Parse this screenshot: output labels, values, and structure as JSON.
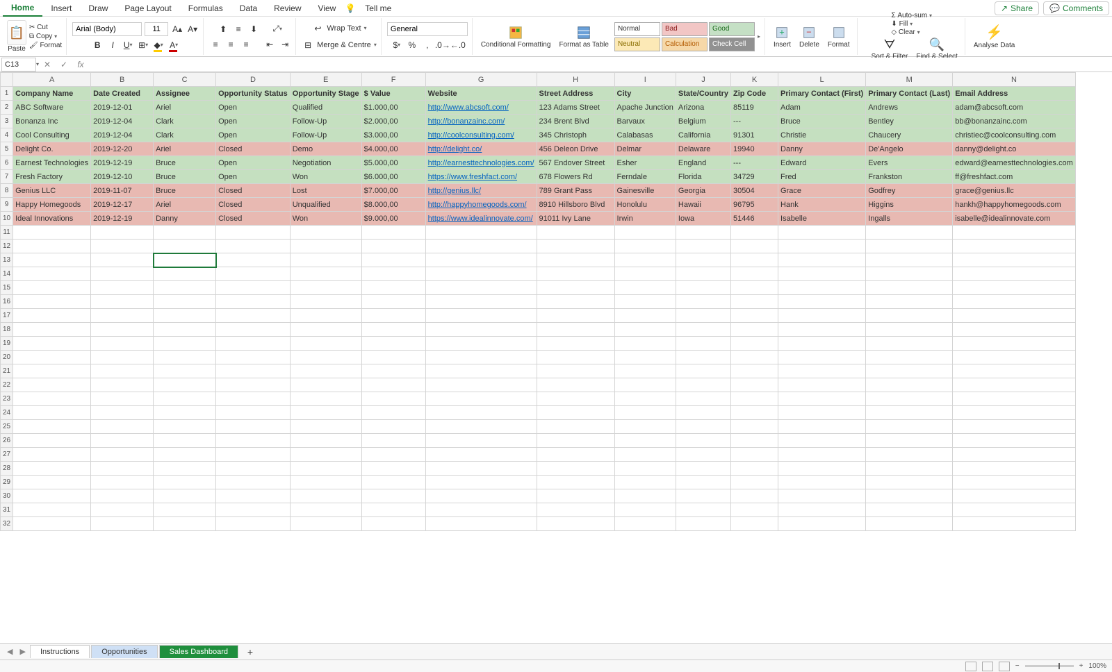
{
  "menu": {
    "tabs": [
      "Home",
      "Insert",
      "Draw",
      "Page Layout",
      "Formulas",
      "Data",
      "Review",
      "View"
    ],
    "tellme": "Tell me",
    "share": "Share",
    "comments": "Comments"
  },
  "ribbon": {
    "paste_lbl": "Paste",
    "cut": "Cut",
    "copy": "Copy",
    "format_p": "Format",
    "font_name": "Arial (Body)",
    "font_size": "11",
    "wrap": "Wrap Text",
    "merge": "Merge & Centre",
    "num_format": "General",
    "cf": "Conditional\nFormatting",
    "fat": "Format\nas Table",
    "styles": {
      "normal": "Normal",
      "bad": "Bad",
      "good": "Good",
      "neutral": "Neutral",
      "calc": "Calculation",
      "check": "Check Cell"
    },
    "insert": "Insert",
    "delete": "Delete",
    "format": "Format",
    "autosum": "Auto-sum",
    "fill": "Fill",
    "clear": "Clear",
    "sortfilter": "Sort &\nFilter",
    "findselect": "Find &\nSelect",
    "analyse": "Analyse\nData"
  },
  "fbar": {
    "cell": "C13"
  },
  "columns": [
    "A",
    "B",
    "C",
    "D",
    "E",
    "F",
    "G",
    "H",
    "I",
    "J",
    "K",
    "L",
    "M",
    "N"
  ],
  "headers": [
    "Company Name",
    "Date Created",
    "Assignee",
    "Opportunity Status",
    "Opportunity Stage",
    "$ Value",
    "Website",
    "Street Address",
    "City",
    "State/Country",
    "Zip Code",
    "Primary Contact (First)",
    "Primary Contact (Last)",
    "Email Address"
  ],
  "rows": [
    {
      "status": "open",
      "c": [
        "ABC Software",
        "2019-12-01",
        "Ariel",
        "Open",
        "Qualified",
        "$1.000,00",
        "http://www.abcsoft.com/",
        "123 Adams Street",
        "Apache Junction",
        "Arizona",
        "85119",
        "Adam",
        "Andrews",
        "adam@abcsoft.com"
      ]
    },
    {
      "status": "open",
      "c": [
        "Bonanza Inc",
        "2019-12-04",
        "Clark",
        "Open",
        "Follow-Up",
        "$2.000,00",
        "http://bonanzainc.com/",
        "234 Brent Blvd",
        "Barvaux",
        "Belgium",
        "---",
        "Bruce",
        "Bentley",
        "bb@bonanzainc.com"
      ]
    },
    {
      "status": "open",
      "c": [
        "Cool Consulting",
        "2019-12-04",
        "Clark",
        "Open",
        "Follow-Up",
        "$3.000,00",
        "http://coolconsulting.com/",
        "345 Christoph",
        "Calabasas",
        "California",
        "91301",
        "Christie",
        "Chaucery",
        "christiec@coolconsulting.com"
      ]
    },
    {
      "status": "closed",
      "c": [
        "Delight Co.",
        "2019-12-20",
        "Ariel",
        "Closed",
        "Demo",
        "$4.000,00",
        "http://delight.co/",
        "456 Deleon Drive",
        "Delmar",
        "Delaware",
        "19940",
        "Danny",
        "De'Angelo",
        "danny@delight.co"
      ]
    },
    {
      "status": "open",
      "c": [
        "Earnest Technologies",
        "2019-12-19",
        "Bruce",
        "Open",
        "Negotiation",
        "$5.000,00",
        "http://earnesttechnologies.com/",
        "567 Endover Street",
        "Esher",
        "England",
        "---",
        "Edward",
        "Evers",
        "edward@earnesttechnologies.com"
      ]
    },
    {
      "status": "open",
      "c": [
        "Fresh Factory",
        "2019-12-10",
        "Bruce",
        "Open",
        "Won",
        "$6.000,00",
        "https://www.freshfact.com/",
        "678 Flowers Rd",
        "Ferndale",
        "Florida",
        "34729",
        "Fred",
        "Frankston",
        "ff@freshfact.com"
      ]
    },
    {
      "status": "closed",
      "c": [
        "Genius LLC",
        "2019-11-07",
        "Bruce",
        "Closed",
        "Lost",
        "$7.000,00",
        "http://genius.llc/",
        "789 Grant Pass",
        "Gainesville",
        "Georgia",
        "30504",
        "Grace",
        "Godfrey",
        "grace@genius.llc"
      ]
    },
    {
      "status": "closed",
      "c": [
        "Happy Homegoods",
        "2019-12-17",
        "Ariel",
        "Closed",
        "Unqualified",
        "$8.000,00",
        "http://happyhomegoods.com/",
        "8910 Hillsboro Blvd",
        "Honolulu",
        "Hawaii",
        "96795",
        "Hank",
        "Higgins",
        "hankh@happyhomegoods.com"
      ]
    },
    {
      "status": "closed",
      "c": [
        "Ideal Innovations",
        "2019-12-19",
        "Danny",
        "Closed",
        "Won",
        "$9.000,00",
        "https://www.idealinnovate.com/",
        "91011 Ivy Lane",
        "Irwin",
        "Iowa",
        "51446",
        "Isabelle",
        "Ingalls",
        "isabelle@idealinnovate.com"
      ]
    }
  ],
  "empty_rows": 22,
  "selected": {
    "row": 13,
    "col": 2
  },
  "tabs": {
    "t1": "Instructions",
    "t2": "Opportunities",
    "t3": "Sales Dashboard"
  },
  "zoom": "100%"
}
